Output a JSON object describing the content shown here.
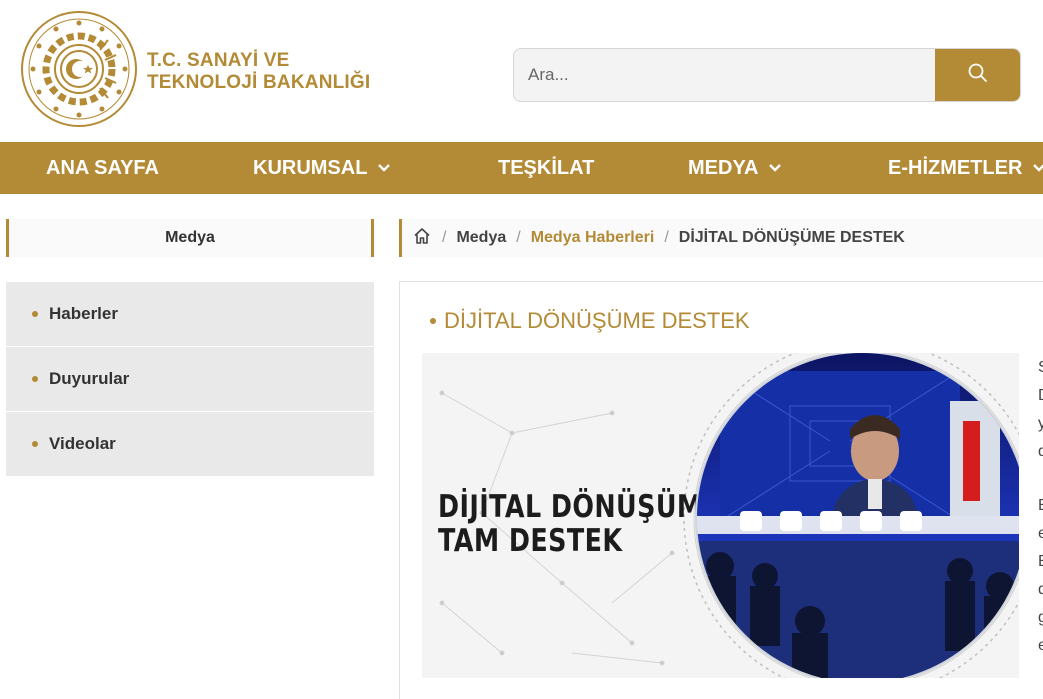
{
  "brand": {
    "line1": "T.C. SANAYİ VE",
    "line2": "TEKNOLOJİ BAKANLIĞI"
  },
  "search": {
    "placeholder": "Ara..."
  },
  "nav": {
    "items": [
      {
        "label": "ANA SAYFA",
        "dropdown": false
      },
      {
        "label": "KURUMSAL",
        "dropdown": true
      },
      {
        "label": "TEŞKİLAT",
        "dropdown": false
      },
      {
        "label": "MEDYA",
        "dropdown": true
      },
      {
        "label": "E-HİZMETLER",
        "dropdown": true
      }
    ]
  },
  "sidebar": {
    "title": "Medya",
    "items": [
      {
        "label": "Haberler"
      },
      {
        "label": "Duyurular"
      },
      {
        "label": "Videolar"
      }
    ]
  },
  "breadcrumb": {
    "items": [
      {
        "label": "Medya"
      },
      {
        "label": "Medya Haberleri"
      },
      {
        "label": "DİJİTAL DÖNÜŞÜME DESTEK"
      }
    ]
  },
  "article": {
    "title": "DİJİTAL DÖNÜŞÜME DESTEK",
    "hero_line1": "DİJİTAL DÖNÜŞÜME",
    "hero_line2": "TAM DESTEK",
    "edge_letters_p1": [
      "S",
      "D",
      "y",
      "d"
    ],
    "edge_letters_p2": [
      "B",
      "e",
      "B",
      "d",
      "g",
      "e"
    ]
  },
  "colors": {
    "accent": "#b38a35",
    "sidebar_bg": "#e9e9e9"
  },
  "icons": {
    "search": "search-icon",
    "home": "home-icon",
    "chevron": "chevron-down-icon",
    "logo": "ministry-emblem-icon"
  }
}
